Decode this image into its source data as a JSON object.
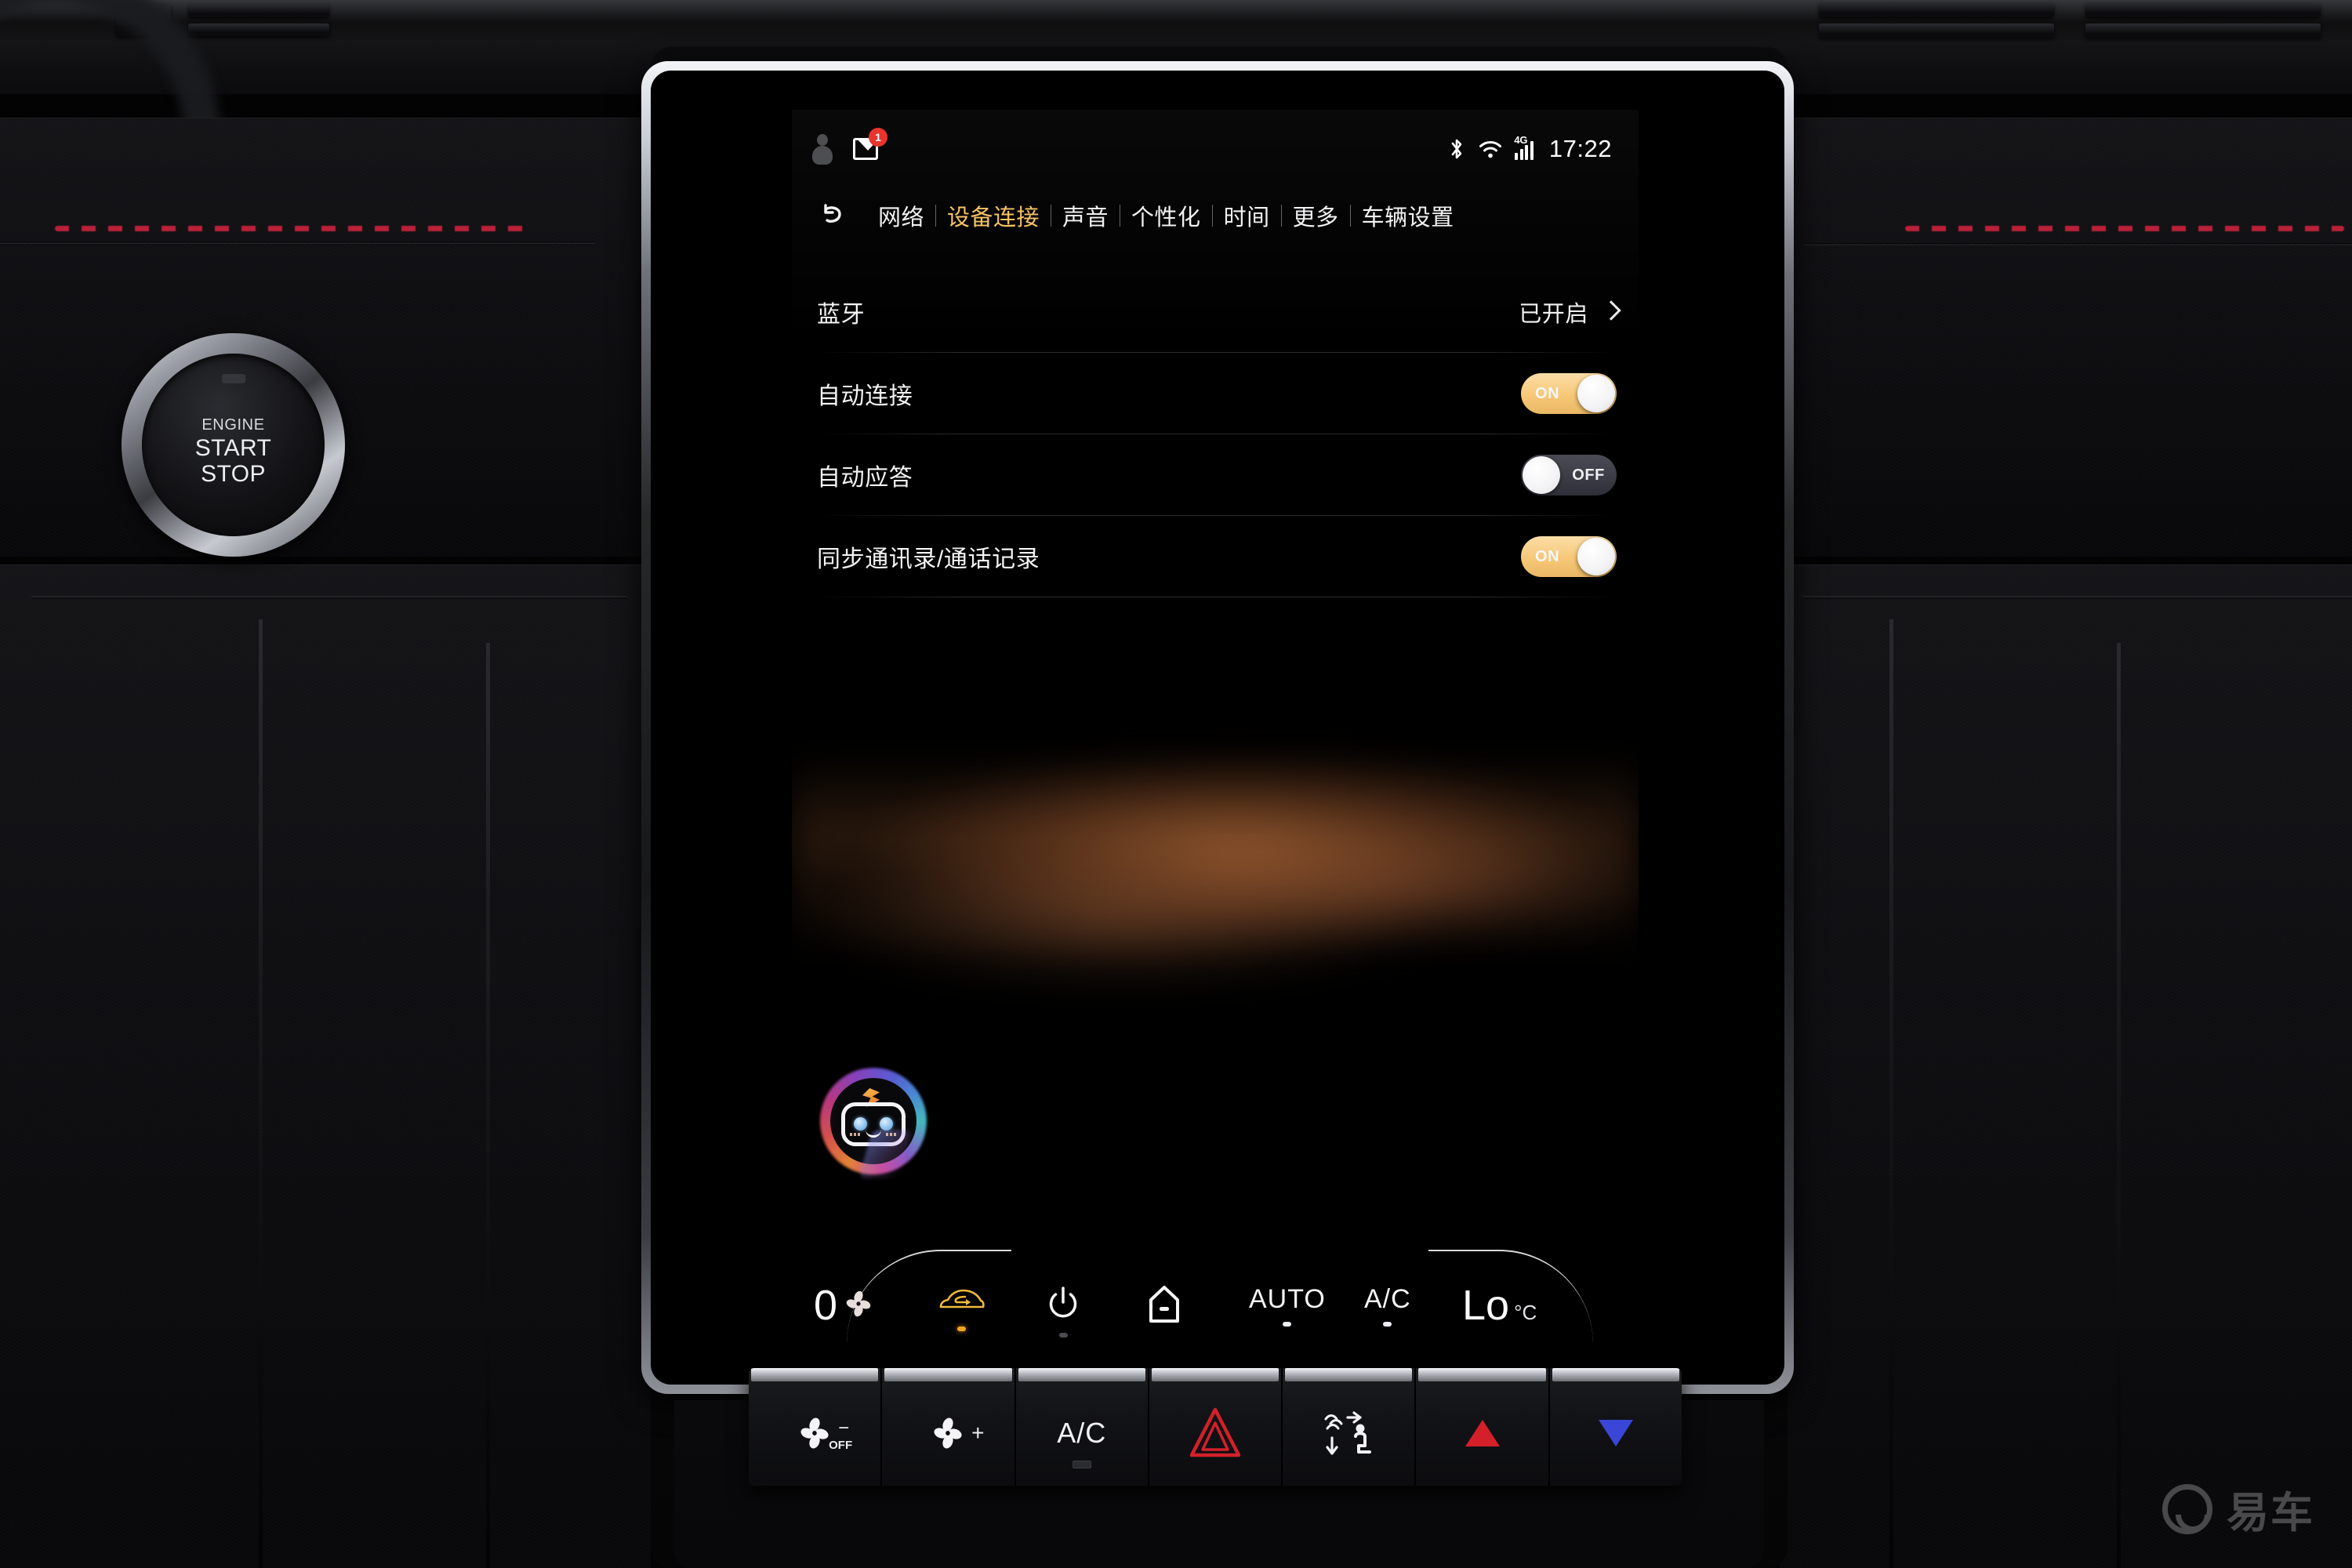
{
  "screen": {
    "statusbar": {
      "profile_icon": "person-icon",
      "message_icon": "mail-icon",
      "message_badge": "1",
      "bluetooth_icon": "bluetooth-icon",
      "wifi_icon": "wifi-icon",
      "network_type": "4G",
      "signal_icon": "cellular-signal-icon",
      "time": "17:22"
    },
    "nav": {
      "back_icon": "back-arrow-icon",
      "tabs": [
        {
          "label": "网络",
          "active": false
        },
        {
          "label": "设备连接",
          "active": true
        },
        {
          "label": "声音",
          "active": false
        },
        {
          "label": "个性化",
          "active": false
        },
        {
          "label": "时间",
          "active": false
        },
        {
          "label": "更多",
          "active": false
        },
        {
          "label": "车辆设置",
          "active": false
        }
      ]
    },
    "settings": [
      {
        "label": "蓝牙",
        "type": "link",
        "value": "已开启",
        "chevron_icon": "chevron-right-icon"
      },
      {
        "label": "自动连接",
        "type": "toggle",
        "state": "ON"
      },
      {
        "label": "自动应答",
        "type": "toggle",
        "state": "OFF"
      },
      {
        "label": "同步通讯录/通话记录",
        "type": "toggle",
        "state": "ON"
      }
    ],
    "assistant": {
      "icon": "voice-assistant-robot-icon"
    },
    "climate": {
      "fan_speed": "0",
      "fan_icon": "fan-blade-icon",
      "recirculation_icon": "air-recirculation-icon",
      "recirculation_active": true,
      "power_icon": "power-icon",
      "airflow_icon": "airflow-face-icon",
      "auto_label": "AUTO",
      "ac_label": "A/C",
      "temperature": "Lo",
      "temperature_unit": "°C"
    }
  },
  "vehicle": {
    "start_stop": {
      "line1": "ENGINE",
      "line2": "START",
      "line3": "STOP"
    },
    "hard_buttons": [
      {
        "name": "fan-down-off-button",
        "glyph": "fan-icon",
        "sign": "−",
        "sub": "OFF"
      },
      {
        "name": "fan-up-button",
        "glyph": "fan-icon",
        "sign": "+",
        "sub": ""
      },
      {
        "name": "ac-button",
        "glyph": "text",
        "label": "A/C"
      },
      {
        "name": "hazard-button",
        "glyph": "hazard-triangle-icon"
      },
      {
        "name": "defrost-airflow-button",
        "glyph": "defrost-airflow-icon"
      },
      {
        "name": "temp-up-button",
        "glyph": "triangle-up-icon"
      },
      {
        "name": "temp-down-button",
        "glyph": "triangle-down-icon"
      }
    ]
  },
  "watermark": {
    "logo_icon": "yiche-logo-icon",
    "text": "易车"
  },
  "colors": {
    "accent": "#f5c265",
    "toggle_on": "#f6c877",
    "toggle_off": "#3a3b45",
    "badge_red": "#e8342c",
    "hazard_red": "#d3202a",
    "temp_down_blue": "#3a46d8",
    "recirculation_amber": "#f0a422",
    "stitching_red": "#c9233c"
  }
}
